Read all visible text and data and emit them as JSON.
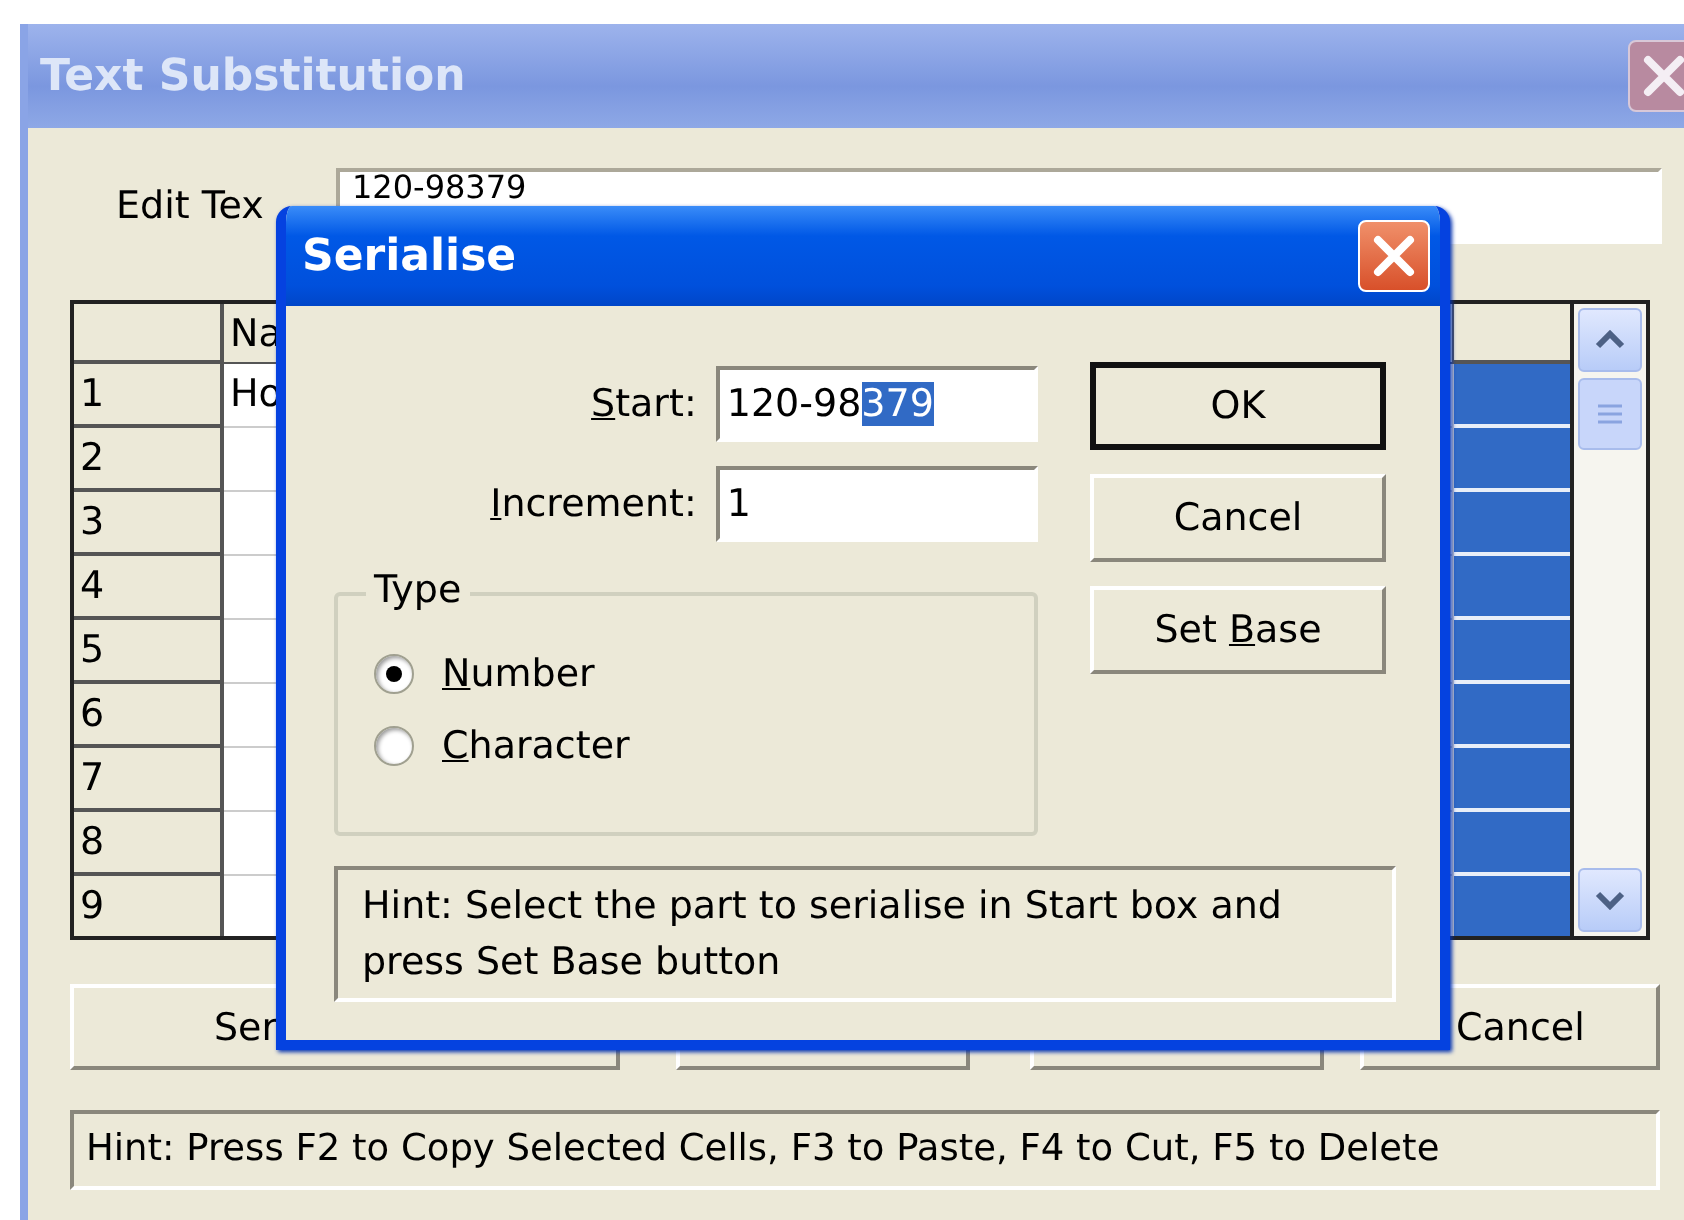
{
  "window": {
    "title": "Text Substitution"
  },
  "edit_text": {
    "label": "Edit Tex",
    "value": "120-98379"
  },
  "grid": {
    "column_header": "Na",
    "rows": [
      {
        "number": "1",
        "name": "Ho",
        "selected": true
      },
      {
        "number": "2",
        "selected": true
      },
      {
        "number": "3",
        "selected": true
      },
      {
        "number": "4",
        "selected": true
      },
      {
        "number": "5",
        "selected": true
      },
      {
        "number": "6",
        "selected": true
      },
      {
        "number": "7",
        "selected": true
      },
      {
        "number": "8",
        "selected": true
      },
      {
        "number": "9",
        "selected": true
      }
    ]
  },
  "buttons": [
    {
      "label": "Ser"
    },
    {
      "label": "Cancel"
    }
  ],
  "hint": "Hint: Press F2 to Copy Selected Cells, F3 to Paste, F4 to Cut, F5 to Delete",
  "dialog": {
    "title": "Serialise",
    "start": {
      "label": {
        "key": "S",
        "rest": "tart:"
      },
      "value": "120-98",
      "selected_text": "379"
    },
    "increment": {
      "label": {
        "key": "I",
        "rest": "ncrement:"
      },
      "value": "1"
    },
    "type_group": {
      "legend": "Type",
      "options": [
        {
          "label": {
            "key": "N",
            "rest": "umber"
          },
          "selected": true
        },
        {
          "label": {
            "key": "C",
            "rest": "haracter"
          },
          "selected": false
        }
      ]
    },
    "buttons": [
      {
        "label": {
          "pre": "OK"
        },
        "default": true
      },
      {
        "label": {
          "pre": "Cancel"
        },
        "default": false
      },
      {
        "label": {
          "pre": "Set ",
          "key": "B",
          "rest": "ase"
        },
        "default": false
      }
    ],
    "hint": "Hint: Select the part to serialise in Start box and press Set Base button"
  }
}
